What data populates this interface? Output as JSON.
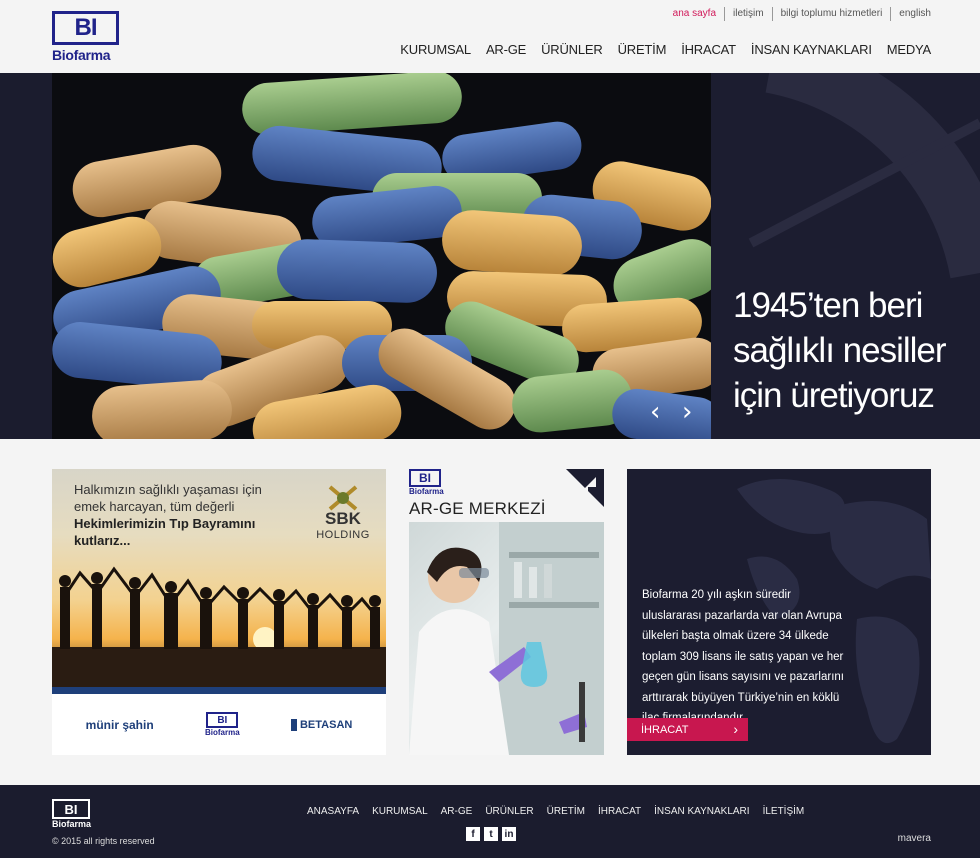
{
  "brand": {
    "logo_mark": "BI",
    "logo_name": "Biofarma"
  },
  "top_links": [
    "ana sayfa",
    "iletişim",
    "bilgi toplumu hizmetleri",
    "english"
  ],
  "main_nav": [
    "KURUMSAL",
    "AR-GE",
    "ÜRÜNLER",
    "ÜRETİM",
    "İHRACAT",
    "İNSAN KAYNAKLARI",
    "MEDYA"
  ],
  "hero": {
    "tagline": "1945’ten beri\nsağlıklı nesiller\niçin üretiyoruz",
    "prev_icon": "chevron-left-icon",
    "next_icon": "chevron-right-icon"
  },
  "card_banner": {
    "line1": "Halkımızın sağlıklı yaşaması için",
    "line2": "emek harcayan, tüm değerli",
    "bold1": "Hekimlerimizin Tıp Bayramını",
    "bold2": "kutlarız...",
    "sbk_title": "SBK",
    "sbk_sub": "HOLDING",
    "logo1": "münir şahin",
    "logo2_mark": "BI",
    "logo2_name": "Biofarma",
    "logo3": "BETASAN"
  },
  "card_arge": {
    "logo_mark": "BI",
    "logo_name": "Biofarma",
    "title": "AR-GE MERKEZİ"
  },
  "card_export": {
    "text": "Biofarma 20 yılı aşkın süredir uluslararası pazarlarda var olan Avrupa ülkeleri başta olmak üzere 34 ülkede toplam 309 lisans ile satış yapan ve her geçen gün lisans sayısını ve pazarlarını arttırarak büyüyen Türkiye’nin en köklü ilaç firmalarındandır.",
    "button": "İHRACAT"
  },
  "footer": {
    "logo_mark": "BI",
    "logo_name": "Biofarma",
    "copyright": "© 2015 all rights reserved",
    "nav": [
      "ANASAYFA",
      "KURUMSAL",
      "AR-GE",
      "ÜRÜNLER",
      "ÜRETİM",
      "İHRACAT",
      "İNSAN KAYNAKLARI",
      "İLETİŞİM"
    ],
    "social": [
      "f",
      "t",
      "in"
    ],
    "credit": "mavera"
  },
  "colors": {
    "navy": "#1b1c2e",
    "accent": "#c8174f",
    "brand_blue": "#20238a"
  }
}
